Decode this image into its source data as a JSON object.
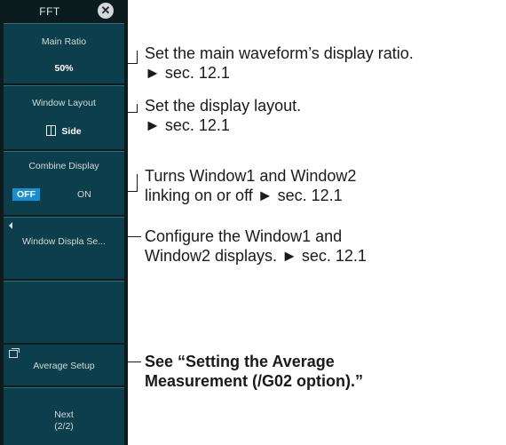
{
  "menu": {
    "title": "FFT",
    "close_glyph": "✕",
    "main_ratio": {
      "label": "Main Ratio",
      "value": "50%"
    },
    "window_layout": {
      "label": "Window Layout",
      "value": "Side",
      "icon": "side-layout-icon"
    },
    "combine_display": {
      "label": "Combine Display",
      "off": "OFF",
      "on": "ON",
      "selected": "OFF"
    },
    "window_display": {
      "label": "Window Displa Se..."
    },
    "average_setup": {
      "label": "Average Setup"
    },
    "next": {
      "label": "Next",
      "page": "(2/2)"
    }
  },
  "notes": {
    "main_ratio": [
      "Set the main waveform’s display ratio.",
      "► sec. 12.1"
    ],
    "window_layout": [
      "Set the display layout.",
      "► sec. 12.1"
    ],
    "combine_display": [
      "Turns Window1 and Window2",
      "linking on or off ► sec. 12.1"
    ],
    "window_display": [
      "Configure the Window1 and",
      "Window2 displays. ► sec. 12.1"
    ],
    "average_setup": [
      "See “Setting the Average",
      "Measurement (/G02 option).”"
    ]
  },
  "colors": {
    "panel": "#0c1b1e",
    "tile": "#0d3e4b",
    "selected": "#1a8fd0"
  }
}
